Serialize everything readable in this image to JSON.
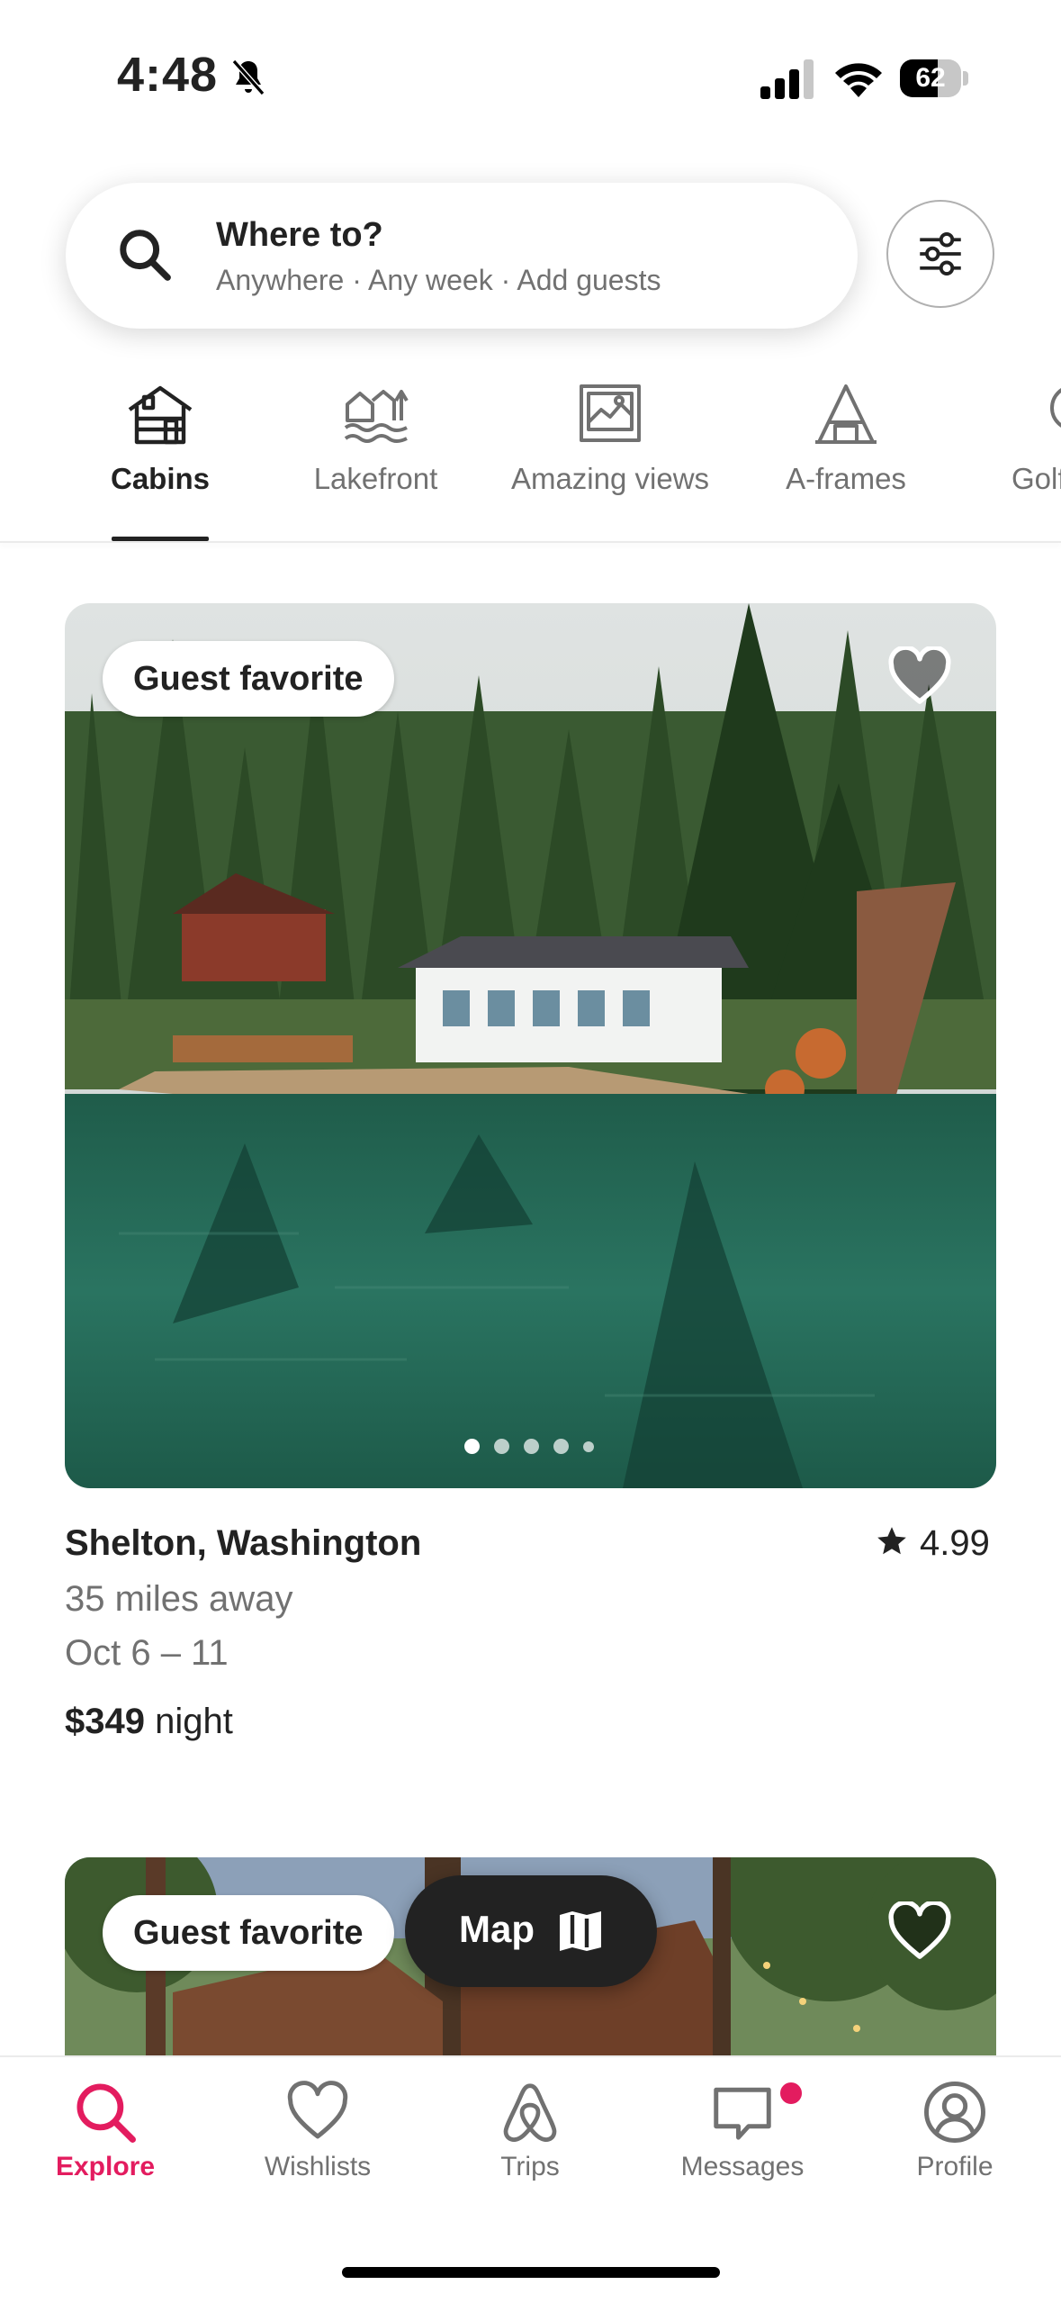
{
  "status_bar": {
    "time": "4:48",
    "battery": "62",
    "battery_level": 0.62
  },
  "search": {
    "title": "Where to?",
    "subtitle": "Anywhere · Any week · Add guests"
  },
  "categories": [
    {
      "label": "Cabins",
      "icon": "cabin-icon",
      "active": true
    },
    {
      "label": "Lakefront",
      "icon": "lakefront-icon",
      "active": false
    },
    {
      "label": "Amazing views",
      "icon": "amazing-views-icon",
      "active": false
    },
    {
      "label": "A-frames",
      "icon": "a-frame-icon",
      "active": false
    },
    {
      "label": "Golf",
      "icon": "golf-icon",
      "active": false
    }
  ],
  "listings": [
    {
      "badge": "Guest favorite",
      "title": "Shelton, Washington",
      "rating": "4.99",
      "distance": "35 miles away",
      "dates": "Oct 6 – 11",
      "price": "$349",
      "price_unit": " night",
      "photo_count": 5,
      "photo_index": 1
    },
    {
      "badge": "Guest favorite"
    }
  ],
  "map_button": {
    "label": "Map"
  },
  "tabs": [
    {
      "label": "Explore",
      "icon": "search-icon",
      "active": true
    },
    {
      "label": "Wishlists",
      "icon": "heart-icon",
      "active": false
    },
    {
      "label": "Trips",
      "icon": "airbnb-logo-icon",
      "active": false
    },
    {
      "label": "Messages",
      "icon": "message-icon",
      "active": false,
      "unread": true
    },
    {
      "label": "Profile",
      "icon": "profile-icon",
      "active": false
    }
  ],
  "colors": {
    "accent": "#e31c5f",
    "text": "#222222",
    "muted": "#717171"
  }
}
